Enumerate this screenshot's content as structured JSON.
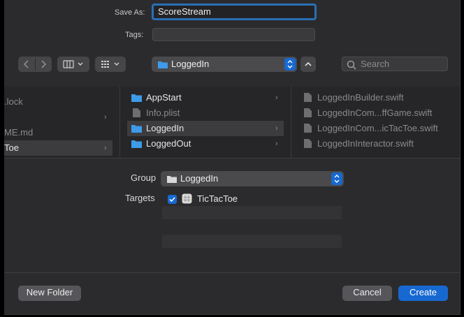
{
  "save_as": {
    "label": "Save As:",
    "value": "ScoreStream"
  },
  "tags": {
    "label": "Tags:",
    "value": ""
  },
  "toolbar": {
    "location": "LoggedIn",
    "search_placeholder": "Search"
  },
  "browser": {
    "col1": [
      {
        "name": ".lock",
        "chevron": false
      },
      {
        "name": "",
        "chevron": true
      },
      {
        "name": "ME.md",
        "chevron": false
      },
      {
        "name": "Toe",
        "chevron": true,
        "selected": true
      }
    ],
    "col2": [
      {
        "name": "AppStart",
        "type": "folder",
        "chevron": true
      },
      {
        "name": "Info.plist",
        "type": "file",
        "dim": true
      },
      {
        "name": "LoggedIn",
        "type": "folder",
        "chevron": true,
        "selected": true
      },
      {
        "name": "LoggedOut",
        "type": "folder",
        "chevron": true
      }
    ],
    "col3": [
      {
        "name": "LoggedInBuilder.swift"
      },
      {
        "name": "LoggedInCom...ffGame.swift"
      },
      {
        "name": "LoggedInCom...icTacToe.swift"
      },
      {
        "name": "LoggedInInteractor.swift"
      }
    ]
  },
  "group": {
    "label": "Group",
    "value": "LoggedIn"
  },
  "targets": {
    "label": "Targets",
    "items": [
      {
        "name": "TicTacToe",
        "checked": true
      }
    ]
  },
  "buttons": {
    "new_folder": "New Folder",
    "cancel": "Cancel",
    "create": "Create"
  },
  "colors": {
    "accent": "#1769d1",
    "folder": "#3d9be9",
    "background": "#2b2b2d"
  }
}
